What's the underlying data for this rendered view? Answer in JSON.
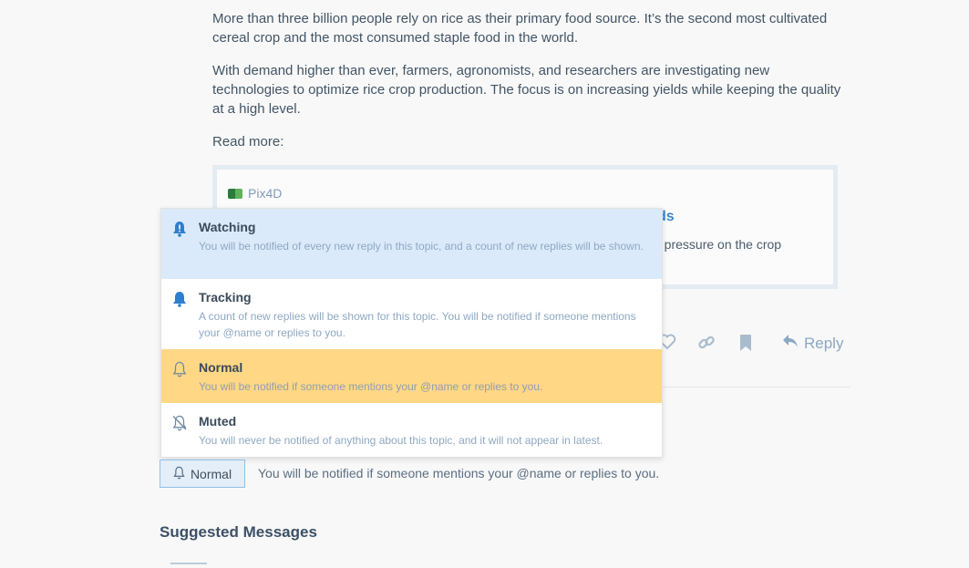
{
  "post": {
    "paragraphs": [
      "More than three billion people rely on rice as their primary food source. It’s the second most cultivated cereal crop and the most consumed staple food in the world.",
      "With demand higher than ever, farmers, agronomists, and researchers are investigating new technologies to optimize rice crop production. The focus is on increasing yields while keeping the quality at a high level.",
      "Read more:"
    ],
    "onebox": {
      "source": "Pix4D",
      "title_visible": "ds",
      "desc_visible": "ith pressure on the crop"
    }
  },
  "actions": {
    "like_icon": "heart-icon",
    "link_icon": "link-icon",
    "bookmark_icon": "bookmark-icon",
    "reply_label": "Reply"
  },
  "notification_menu": {
    "items": [
      {
        "title": "Watching",
        "desc": "You will be notified of every new reply in this topic, and a count of new replies will be shown.",
        "icon": "bell-exclamation-icon"
      },
      {
        "title": "Tracking",
        "desc": "A count of new replies will be shown for this topic. You will be notified if someone mentions your @name or replies to you.",
        "icon": "bell-icon"
      },
      {
        "title": "Normal",
        "desc": "You will be notified if someone mentions your @name or replies to you.",
        "icon": "bell-outline-icon"
      },
      {
        "title": "Muted",
        "desc": "You will never be notified of anything about this topic, and it will not appear in latest.",
        "icon": "bell-slash-icon"
      }
    ]
  },
  "notification_button": {
    "label": "Normal",
    "description": "You will be notified if someone mentions your @name or replies to you."
  },
  "suggested": {
    "heading": "Suggested Messages"
  },
  "colors": {
    "accent": "#3a86c6",
    "watching_bg": "#dbeafa",
    "selected_bg": "#ffd785"
  }
}
